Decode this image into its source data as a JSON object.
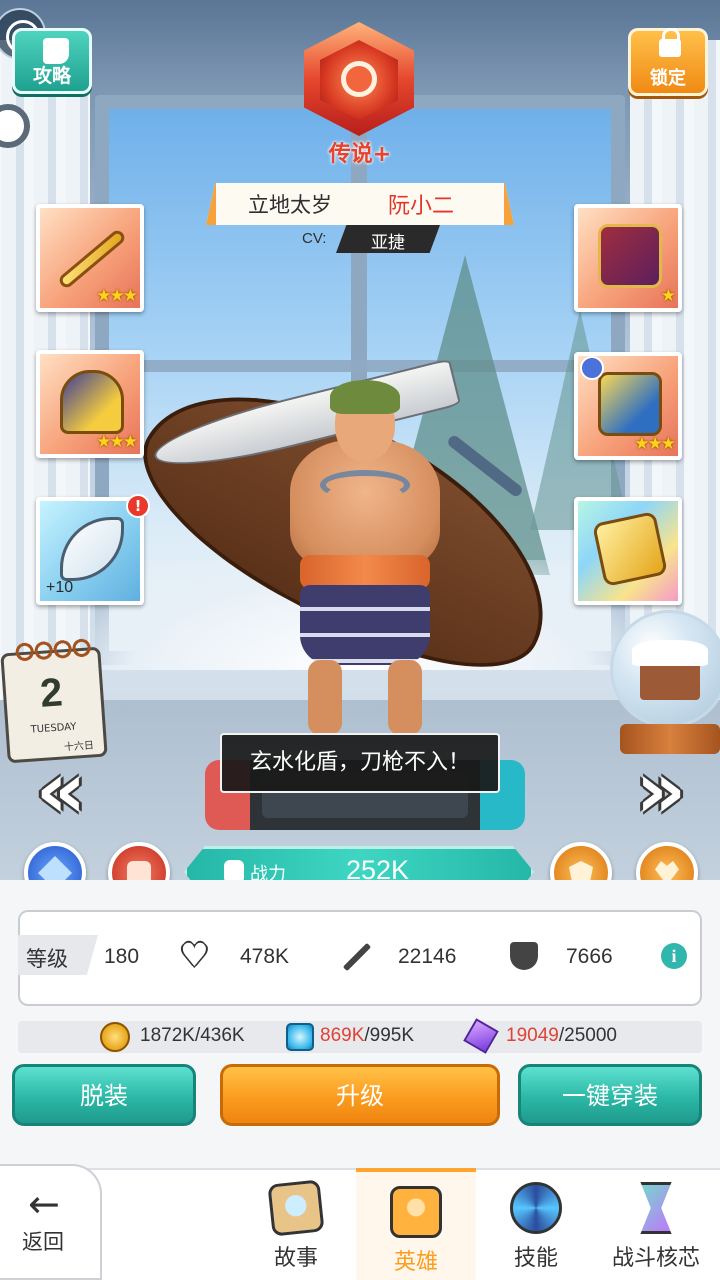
{
  "top": {
    "guide_label": "攻略",
    "lock_label": "锁定",
    "rarity_label": "传说+"
  },
  "hero": {
    "title": "立地太岁",
    "name": "阮小二",
    "cv_label": "CV:",
    "cv_name": "亚捷",
    "quote": "玄水化盾，刀枪不入！"
  },
  "equipment": {
    "left": [
      {
        "icon": "golden-spear-icon",
        "stars": "★★★"
      },
      {
        "icon": "helmet-icon",
        "stars": "★★★"
      },
      {
        "icon": "saber-icon",
        "level": "+10",
        "alert": "!"
      }
    ],
    "right": [
      {
        "icon": "armor-icon",
        "stars": "★"
      },
      {
        "icon": "boots-icon",
        "stars": "★★★"
      },
      {
        "icon": "token-icon"
      }
    ]
  },
  "calendar": {
    "day": "2",
    "weekday": "TUESDAY",
    "lunar": "十六日"
  },
  "power": {
    "label": "战力",
    "value": "252K"
  },
  "stats": {
    "level_label": "等级",
    "level": "180",
    "hp": "478K",
    "attack": "22146",
    "defense": "7666"
  },
  "resources": {
    "gold": "1872K/436K",
    "chip_current": "869K",
    "chip_total": "/995K",
    "cube_current": "19049",
    "cube_total": "/25000"
  },
  "actions": {
    "unequip": "脱装",
    "upgrade": "升级",
    "equip_all": "一键穿装"
  },
  "tabs": {
    "back": "返回",
    "story": "故事",
    "hero": "英雄",
    "skill": "技能",
    "core": "战斗核芯"
  },
  "colors": {
    "accent_teal": "#2bb8a6",
    "accent_orange": "#fb9c1f",
    "legend_red": "#e8412c",
    "active_tab": "#ff9c1e"
  }
}
